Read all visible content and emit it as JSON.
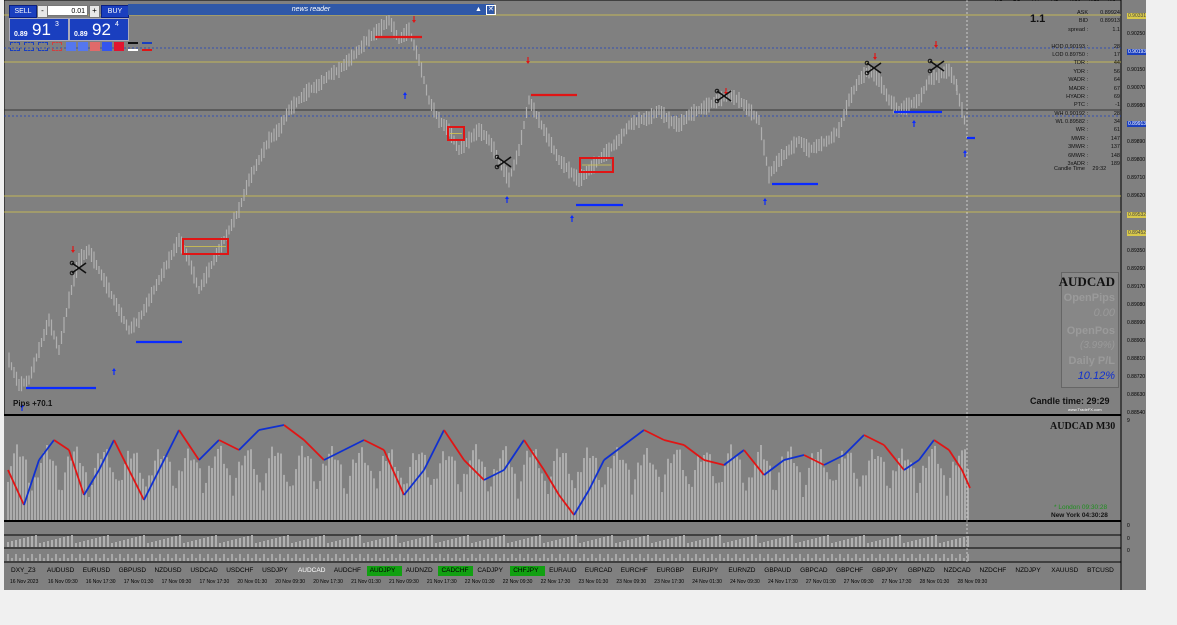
{
  "trade_panel": {
    "sell_label": "SELL",
    "buy_label": "BUY",
    "lot_minus": "-",
    "lot_plus": "+",
    "lot_value": "0.01",
    "bid": {
      "small": "0.89",
      "big": "91",
      "sup": "3"
    },
    "ask": {
      "small": "0.89",
      "big": "92",
      "sup": "4"
    }
  },
  "news_reader": {
    "title": "news reader",
    "minimize": "▲",
    "close": "✕"
  },
  "timeframes": [
    "W1",
    "D1",
    "H4",
    "H1",
    "M30",
    "M15",
    "M5"
  ],
  "spread_display": "1.1",
  "stats": [
    {
      "label": "ASK",
      "value": "0.89924"
    },
    {
      "label": "BID",
      "value": "0.89913"
    },
    {
      "label": "spread :",
      "value": "1.1"
    },
    {
      "label": "",
      "value": ""
    },
    {
      "label": "HOD 0.90193 :",
      "value": "28"
    },
    {
      "label": "LOD 0.89750 :",
      "value": "17"
    },
    {
      "label": "TDR :",
      "value": "44"
    },
    {
      "label": "YDR :",
      "value": "56"
    },
    {
      "label": "WADR :",
      "value": "64"
    },
    {
      "label": "MADR :",
      "value": "67"
    },
    {
      "label": "HYADR :",
      "value": "69"
    },
    {
      "label": "PTC :",
      "value": "-1"
    },
    {
      "label": "WH 0.90192 :",
      "value": "28"
    },
    {
      "label": "WL 0.89582 :",
      "value": "34"
    },
    {
      "label": "WR :",
      "value": "61"
    },
    {
      "label": "MWR :",
      "value": "147"
    },
    {
      "label": "3MWR :",
      "value": "137"
    },
    {
      "label": "6MWR :",
      "value": "148"
    },
    {
      "label": "3xADR :",
      "value": "189"
    }
  ],
  "candle_time_small": {
    "label": "Candle Time",
    "value": "29:32"
  },
  "info_box": {
    "symbol": "AUDCAD",
    "open_pips_label": "OpenPips",
    "open_pips_value": "0.00",
    "open_pos_label": "OpenPos",
    "open_pos_value": "(3.99%)",
    "daily_pl_label": "Daily P/L",
    "daily_pl_value": "10.12%"
  },
  "candle_time_big": "Candle time:  29:29",
  "watermark": "www.TradeFX.com",
  "pips_label": "Pips +70.1",
  "indicator_title": "AUDCAD  M30",
  "sessions": {
    "london": "* London  09:30:28",
    "new_york": "New York  04:30:28"
  },
  "right_axis": [
    "0.90331",
    "0.90250",
    "0.90193",
    "0.90150",
    "0.90070",
    "0.89980",
    "0.89913",
    "0.89890",
    "0.89800",
    "0.89710",
    "0.89620",
    "0.89532",
    "0.89452",
    "0.89350",
    "0.89260",
    "0.89170",
    "0.89080",
    "0.88990",
    "0.88900",
    "0.88810",
    "0.88720",
    "0.88630",
    "0.88540"
  ],
  "indicator_axis": [
    "9",
    "0",
    "0",
    "0"
  ],
  "price_marker_labels": [
    {
      "text": "1",
      "y": 0.0
    },
    {
      "text": "2",
      "y": 0.0
    },
    {
      "text": "3",
      "y": 0.0
    },
    {
      "text": "4",
      "y": 0.0
    }
  ],
  "symbols": [
    {
      "name": "DXY_Z3",
      "style": ""
    },
    {
      "name": "AUDUSD",
      "style": ""
    },
    {
      "name": "EURUSD",
      "style": ""
    },
    {
      "name": "GBPUSD",
      "style": ""
    },
    {
      "name": "NZDUSD",
      "style": ""
    },
    {
      "name": "USDCAD",
      "style": ""
    },
    {
      "name": "USDCHF",
      "style": ""
    },
    {
      "name": "USDJPY",
      "style": ""
    },
    {
      "name": "AUDCAD",
      "style": "active"
    },
    {
      "name": "AUDCHF",
      "style": ""
    },
    {
      "name": "AUDJPY",
      "style": "green"
    },
    {
      "name": "AUDNZD",
      "style": ""
    },
    {
      "name": "CADCHF",
      "style": "green"
    },
    {
      "name": "CADJPY",
      "style": ""
    },
    {
      "name": "CHFJPY",
      "style": "green"
    },
    {
      "name": "EURAUD",
      "style": ""
    },
    {
      "name": "EURCAD",
      "style": ""
    },
    {
      "name": "EURCHF",
      "style": ""
    },
    {
      "name": "EURGBP",
      "style": ""
    },
    {
      "name": "EURJPY",
      "style": ""
    },
    {
      "name": "EURNZD",
      "style": ""
    },
    {
      "name": "GBPAUD",
      "style": ""
    },
    {
      "name": "GBPCAD",
      "style": ""
    },
    {
      "name": "GBPCHF",
      "style": ""
    },
    {
      "name": "GBPJPY",
      "style": ""
    },
    {
      "name": "GBPNZD",
      "style": ""
    },
    {
      "name": "NZDCAD",
      "style": ""
    },
    {
      "name": "NZDCHF",
      "style": ""
    },
    {
      "name": "NZDJPY",
      "style": ""
    },
    {
      "name": "XAUUSD",
      "style": ""
    },
    {
      "name": "BTCUSD",
      "style": ""
    }
  ],
  "time_labels": [
    "16 Nov 2023",
    "16 Nov 09:30",
    "16 Nov 17:30",
    "17 Nov 01:30",
    "17 Nov 09:30",
    "17 Nov 17:30",
    "20 Nov 01:30",
    "20 Nov 09:30",
    "20 Nov 17:30",
    "21 Nov 01:30",
    "21 Nov 09:30",
    "21 Nov 17:30",
    "22 Nov 01:30",
    "22 Nov 09:30",
    "22 Nov 17:30",
    "23 Nov 01:30",
    "23 Nov 09:30",
    "23 Nov 17:30",
    "24 Nov 01:30",
    "24 Nov 09:30",
    "24 Nov 17:30",
    "27 Nov 01:30",
    "27 Nov 09:30",
    "27 Nov 17:30",
    "28 Nov 01:30",
    "28 Nov 09:30"
  ],
  "colors": {
    "chart_bg": "#808080",
    "panel_blue": "#1a3fbf",
    "yellow_line": "#d8c84a",
    "blue_level": "#0a2aff",
    "red_level": "#e01515",
    "osc_up": "#1030d0",
    "osc_down": "#e01515",
    "green_symbol": "#11a011"
  }
}
